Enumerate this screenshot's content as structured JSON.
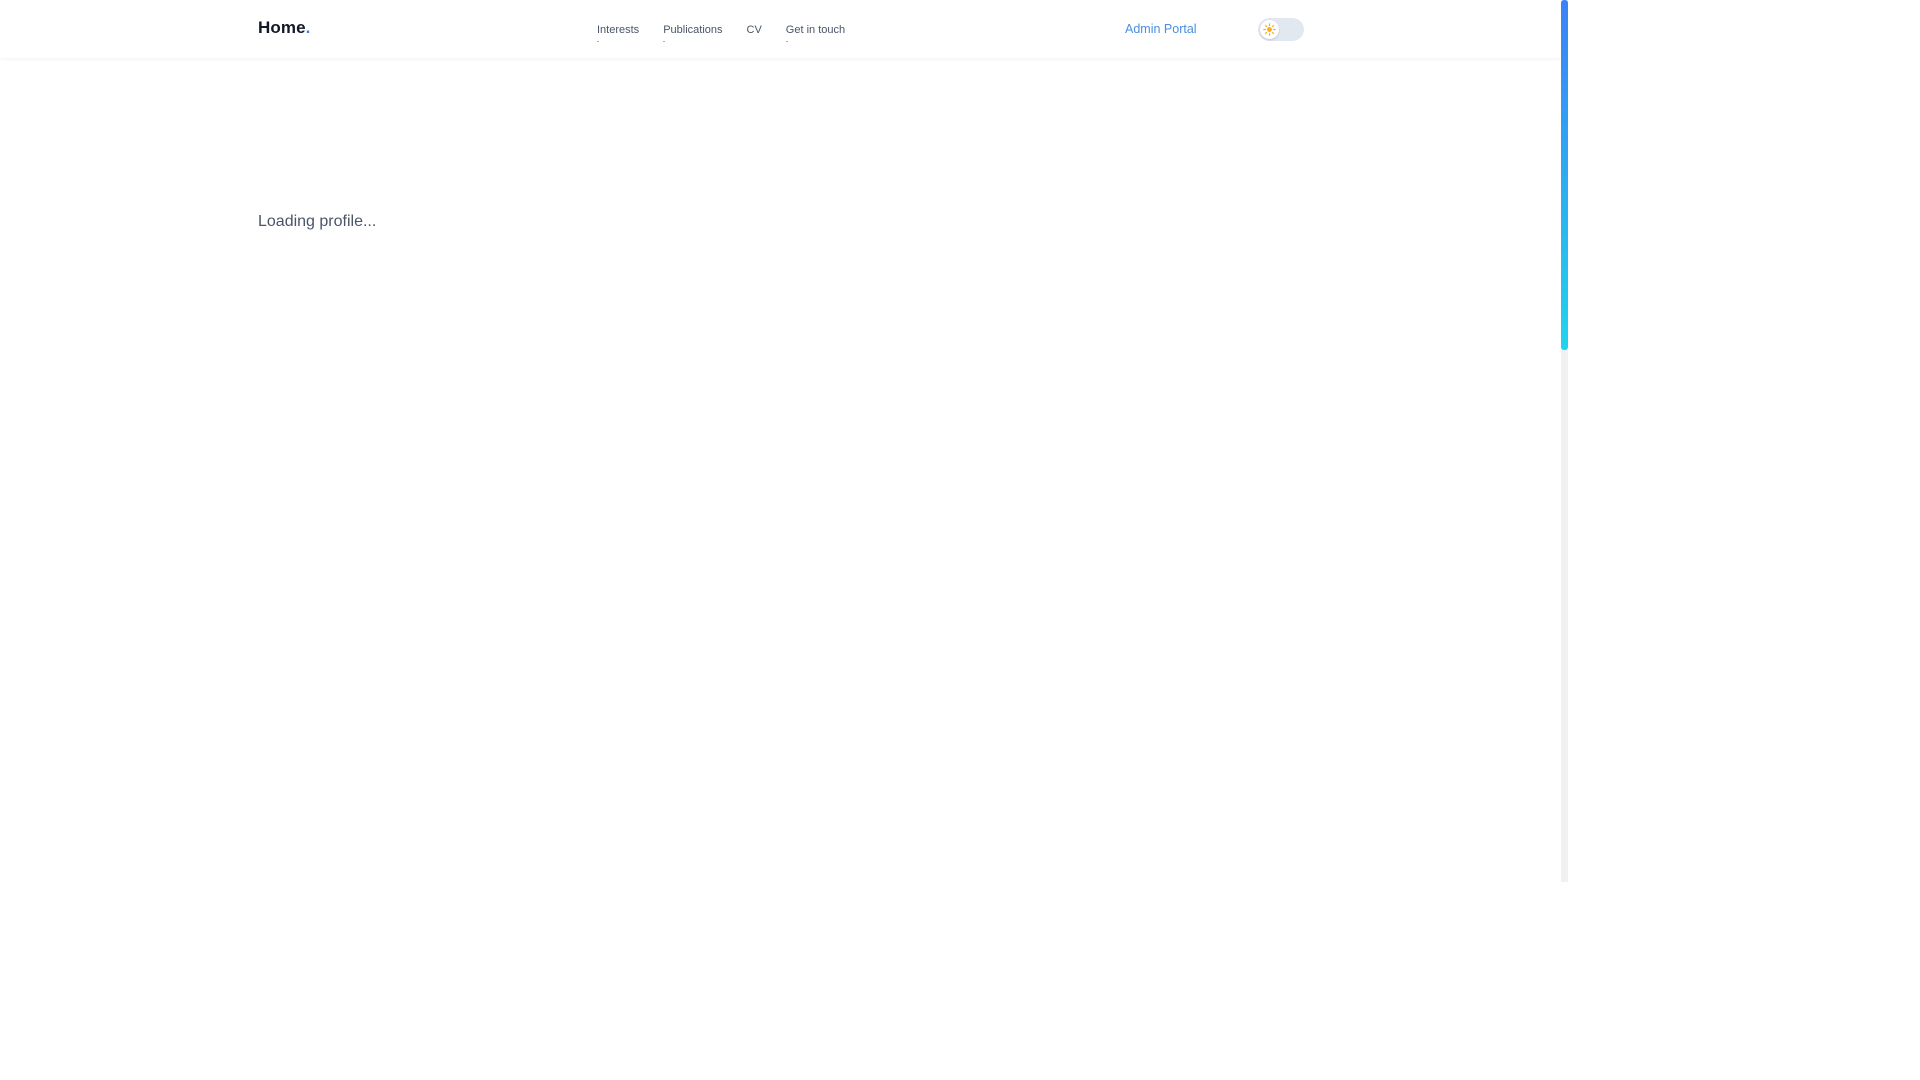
{
  "header": {
    "brand": "Home",
    "brand_dot": ".",
    "nav": [
      {
        "label": "Interests"
      },
      {
        "label": "Publications"
      },
      {
        "label": "CV"
      },
      {
        "label": "Get in touch"
      }
    ],
    "admin_label": "Admin Portal",
    "theme_toggle": {
      "state": "light",
      "icon": "sun-icon"
    }
  },
  "main": {
    "status_text": "Loading profile..."
  },
  "colors": {
    "accent": "#3b82f6",
    "admin_link": "#4a8fe0",
    "scroll_gradient_start": "#3b82f6",
    "scroll_gradient_end": "#22d3ee"
  }
}
